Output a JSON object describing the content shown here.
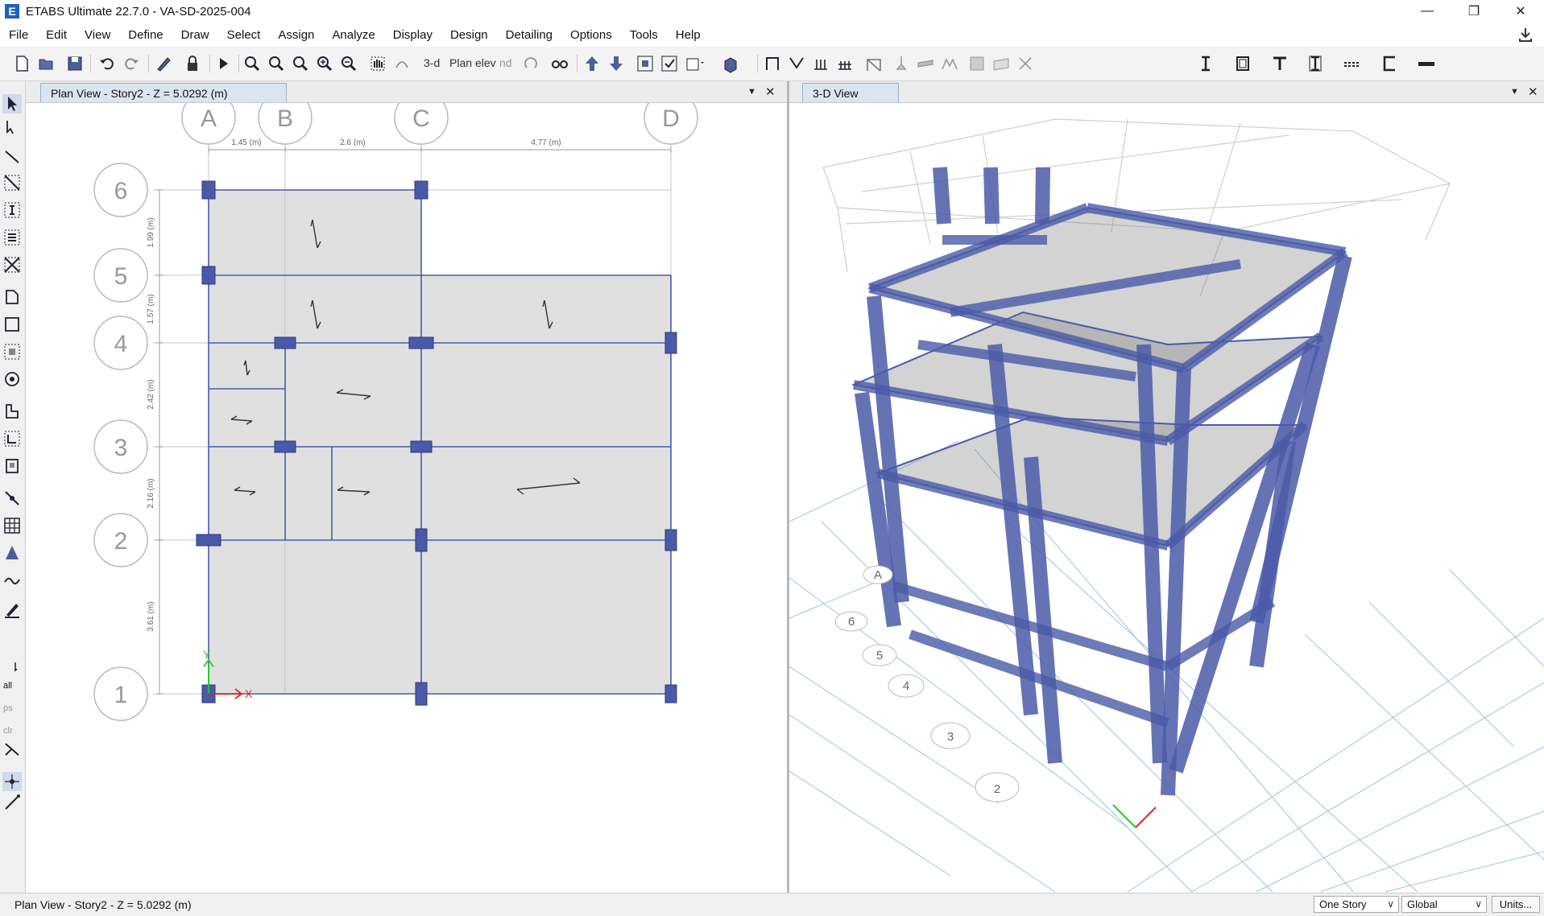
{
  "window": {
    "title": "ETABS Ultimate 22.7.0 - VA-SD-2025-004",
    "logo_letter": "E",
    "minimize": "—",
    "restore": "❐",
    "close": "✕"
  },
  "menu": {
    "items": [
      "File",
      "Edit",
      "View",
      "Define",
      "Draw",
      "Select",
      "Assign",
      "Analyze",
      "Display",
      "Design",
      "Detailing",
      "Options",
      "Tools",
      "Help"
    ]
  },
  "toolbar": {
    "view_3d_label": "3-d",
    "plan_label": "Plan",
    "elev_label": "elev",
    "nd_label": "nd"
  },
  "lefttools": {
    "all_label": "all",
    "ps_label": "ps",
    "clr_label": "clr"
  },
  "plan_view": {
    "tab_label": "Plan View - Story2 - Z = 5.0292 (m)",
    "dropdown_glyph": "▼",
    "close_glyph": "✕",
    "grid_columns": [
      "A",
      "B",
      "C",
      "D"
    ],
    "grid_rows": [
      "6",
      "5",
      "4",
      "3",
      "2",
      "1"
    ],
    "x_spacings": [
      "1.45 (m)",
      "2.6 (m)",
      "4.77 (m)"
    ],
    "y_spacings": [
      "1.99 (m)",
      "1.57 (m)",
      "2.42 (m)",
      "2.16 (m)",
      "3.61 (m)"
    ],
    "axis_x_label": "X",
    "axis_y_label": "Y"
  },
  "view_3d": {
    "tab_label": "3-D View",
    "dropdown_glyph": "▼",
    "close_glyph": "✕",
    "grid_bubbles": [
      "A",
      "6",
      "5",
      "4",
      "3",
      "2"
    ]
  },
  "status": {
    "text": "Plan View - Story2 - Z = 5.0292 (m)",
    "story_select": "One Story",
    "coord_select": "Global",
    "units_button": "Units..."
  },
  "colors": {
    "member": "#4a5aa8",
    "slab": "#e0e0e0",
    "tab_bg": "#dbe5f1",
    "grid_3d": "#9cc4e4"
  }
}
